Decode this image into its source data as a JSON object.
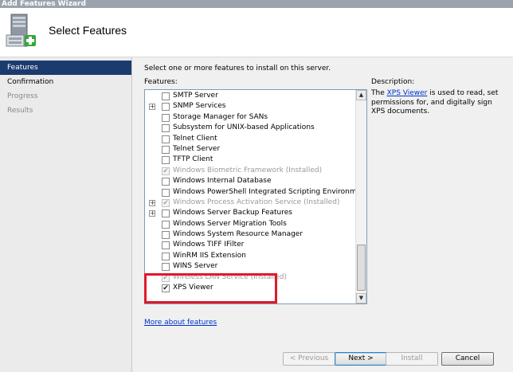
{
  "window": {
    "title": "Add Features Wizard"
  },
  "header": {
    "title": "Select Features",
    "icon": "server-add-icon"
  },
  "nav": {
    "items": [
      {
        "label": "Features",
        "state": "active"
      },
      {
        "label": "Confirmation",
        "state": "normal"
      },
      {
        "label": "Progress",
        "state": "disabled"
      },
      {
        "label": "Results",
        "state": "disabled"
      }
    ]
  },
  "main": {
    "intro": "Select one or more features to install on this server.",
    "features_label": "Features:",
    "description_label": "Description:",
    "description": {
      "prefix": "The ",
      "link": "XPS Viewer",
      "suffix": " is used to read, set permissions for, and digitally sign XPS documents."
    },
    "features": [
      {
        "label": "SMTP Server",
        "expandable": false,
        "state": "unchecked"
      },
      {
        "label": "SNMP Services",
        "expandable": true,
        "state": "unchecked"
      },
      {
        "label": "Storage Manager for SANs",
        "expandable": false,
        "state": "unchecked"
      },
      {
        "label": "Subsystem for UNIX-based Applications",
        "expandable": false,
        "state": "unchecked"
      },
      {
        "label": "Telnet Client",
        "expandable": false,
        "state": "unchecked"
      },
      {
        "label": "Telnet Server",
        "expandable": false,
        "state": "unchecked"
      },
      {
        "label": "TFTP Client",
        "expandable": false,
        "state": "unchecked"
      },
      {
        "label": "Windows Biometric Framework  (Installed)",
        "expandable": false,
        "state": "installed"
      },
      {
        "label": "Windows Internal Database",
        "expandable": false,
        "state": "unchecked"
      },
      {
        "label": "Windows PowerShell Integrated Scripting Environment (IS",
        "expandable": false,
        "state": "unchecked"
      },
      {
        "label": "Windows Process Activation Service  (Installed)",
        "expandable": true,
        "state": "installed"
      },
      {
        "label": "Windows Server Backup Features",
        "expandable": true,
        "state": "unchecked"
      },
      {
        "label": "Windows Server Migration Tools",
        "expandable": false,
        "state": "unchecked"
      },
      {
        "label": "Windows System Resource Manager",
        "expandable": false,
        "state": "unchecked"
      },
      {
        "label": "Windows TIFF IFilter",
        "expandable": false,
        "state": "unchecked"
      },
      {
        "label": "WinRM IIS Extension",
        "expandable": false,
        "state": "unchecked"
      },
      {
        "label": "WINS Server",
        "expandable": false,
        "state": "unchecked"
      },
      {
        "label": "Wireless LAN Service  (Installed)",
        "expandable": false,
        "state": "installed"
      },
      {
        "label": "XPS Viewer",
        "expandable": false,
        "state": "checked"
      }
    ],
    "more_link": "More about features",
    "highlight_color": "#e0192a"
  },
  "buttons": {
    "previous": "< Previous",
    "next": "Next >",
    "install": "Install",
    "cancel": "Cancel"
  },
  "colors": {
    "nav_active": "#1b3b6f",
    "link": "#0033cc"
  }
}
